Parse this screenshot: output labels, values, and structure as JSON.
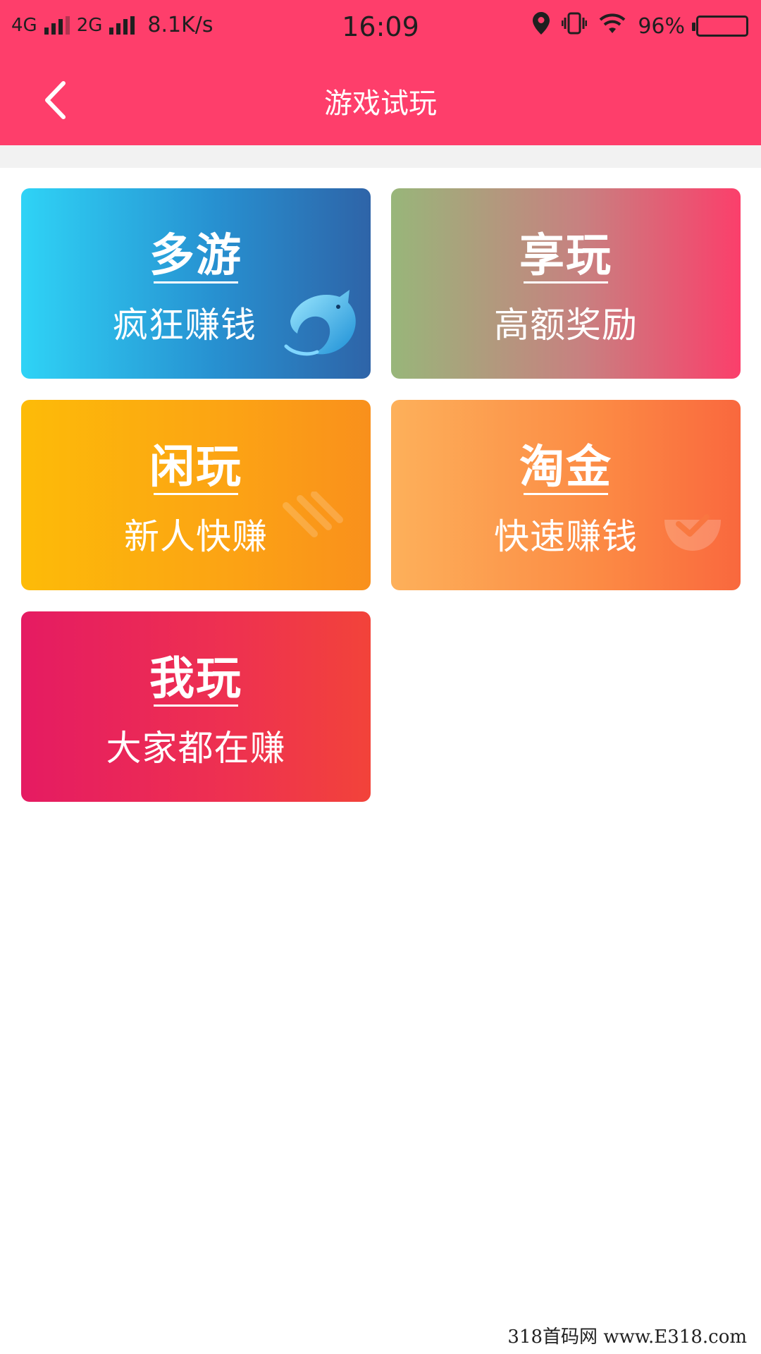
{
  "status_bar": {
    "network_1": "4G",
    "network_2": "2G",
    "speed": "8.1K/s",
    "time": "16:09",
    "battery": "96%",
    "icons": [
      "location-icon",
      "vibrate-icon",
      "wifi-icon",
      "battery-icon"
    ]
  },
  "header": {
    "title": "游戏试玩",
    "back_icon": "chevron-left-icon",
    "background_color": "#fe3e6b"
  },
  "cards": [
    {
      "title": "多游",
      "subtitle": "疯狂赚钱",
      "icon": "dolphin-icon"
    },
    {
      "title": "享玩",
      "subtitle": "高额奖励"
    },
    {
      "title": "闲玩",
      "subtitle": "新人快赚",
      "icon": "sparkle-icon"
    },
    {
      "title": "淘金",
      "subtitle": "快速赚钱",
      "icon": "gold-bowl-icon"
    },
    {
      "title": "我玩",
      "subtitle": "大家都在赚"
    }
  ],
  "watermark": "318首码网 www.E318.com"
}
